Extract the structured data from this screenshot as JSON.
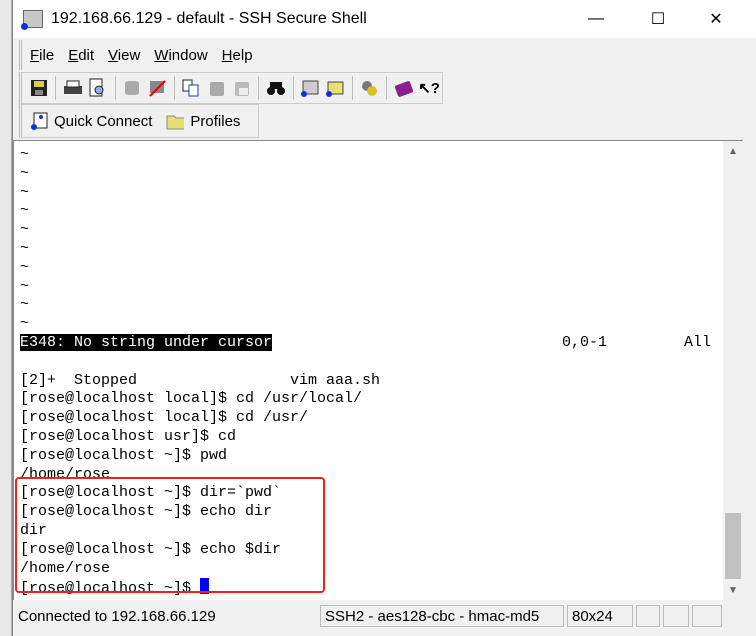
{
  "window": {
    "title": "192.168.66.129 - default - SSH Secure Shell",
    "minimize": "—",
    "maximize": "☐",
    "close": "✕"
  },
  "menu": [
    {
      "key": "F",
      "rest": "ile"
    },
    {
      "key": "E",
      "rest": "dit"
    },
    {
      "key": "V",
      "rest": "iew"
    },
    {
      "key": "W",
      "rest": "indow"
    },
    {
      "key": "H",
      "rest": "elp"
    }
  ],
  "toolbar": {
    "icons": [
      "save-icon",
      "print-icon",
      "print-preview-icon",
      "connect-icon",
      "disconnect-icon",
      "copy-icon",
      "paste-icon",
      "paste-special-icon",
      "find-icon",
      "new-terminal-icon",
      "new-file-transfer-icon",
      "settings-icon",
      "help-icon",
      "context-help-icon"
    ]
  },
  "quickbar": {
    "quick_connect": "Quick Connect",
    "profiles": "Profiles"
  },
  "terminal": {
    "tildes": [
      "~",
      "~",
      "~",
      "~",
      "~",
      "~",
      "~",
      "~",
      "~",
      "~"
    ],
    "vim_error": "E348: No string under cursor",
    "vim_position": "0,0-1",
    "vim_scroll": "All",
    "lines": [
      "[2]+  Stopped                 vim aaa.sh",
      "[rose@localhost local]$ cd /usr/local/",
      "[rose@localhost local]$ cd /usr/",
      "[rose@localhost usr]$ cd",
      "[rose@localhost ~]$ pwd",
      "/home/rose",
      "[rose@localhost ~]$ dir=`pwd`",
      "[rose@localhost ~]$ echo dir",
      "dir",
      "[rose@localhost ~]$ echo $dir",
      "/home/rose"
    ],
    "prompt": "[rose@localhost ~]$ ",
    "highlight_color": "#f02020",
    "cursor_color": "#0000ff"
  },
  "status": {
    "connection": "Connected to 192.168.66.129",
    "cipher": "SSH2 - aes128-cbc - hmac-md5",
    "size": "80x24"
  }
}
